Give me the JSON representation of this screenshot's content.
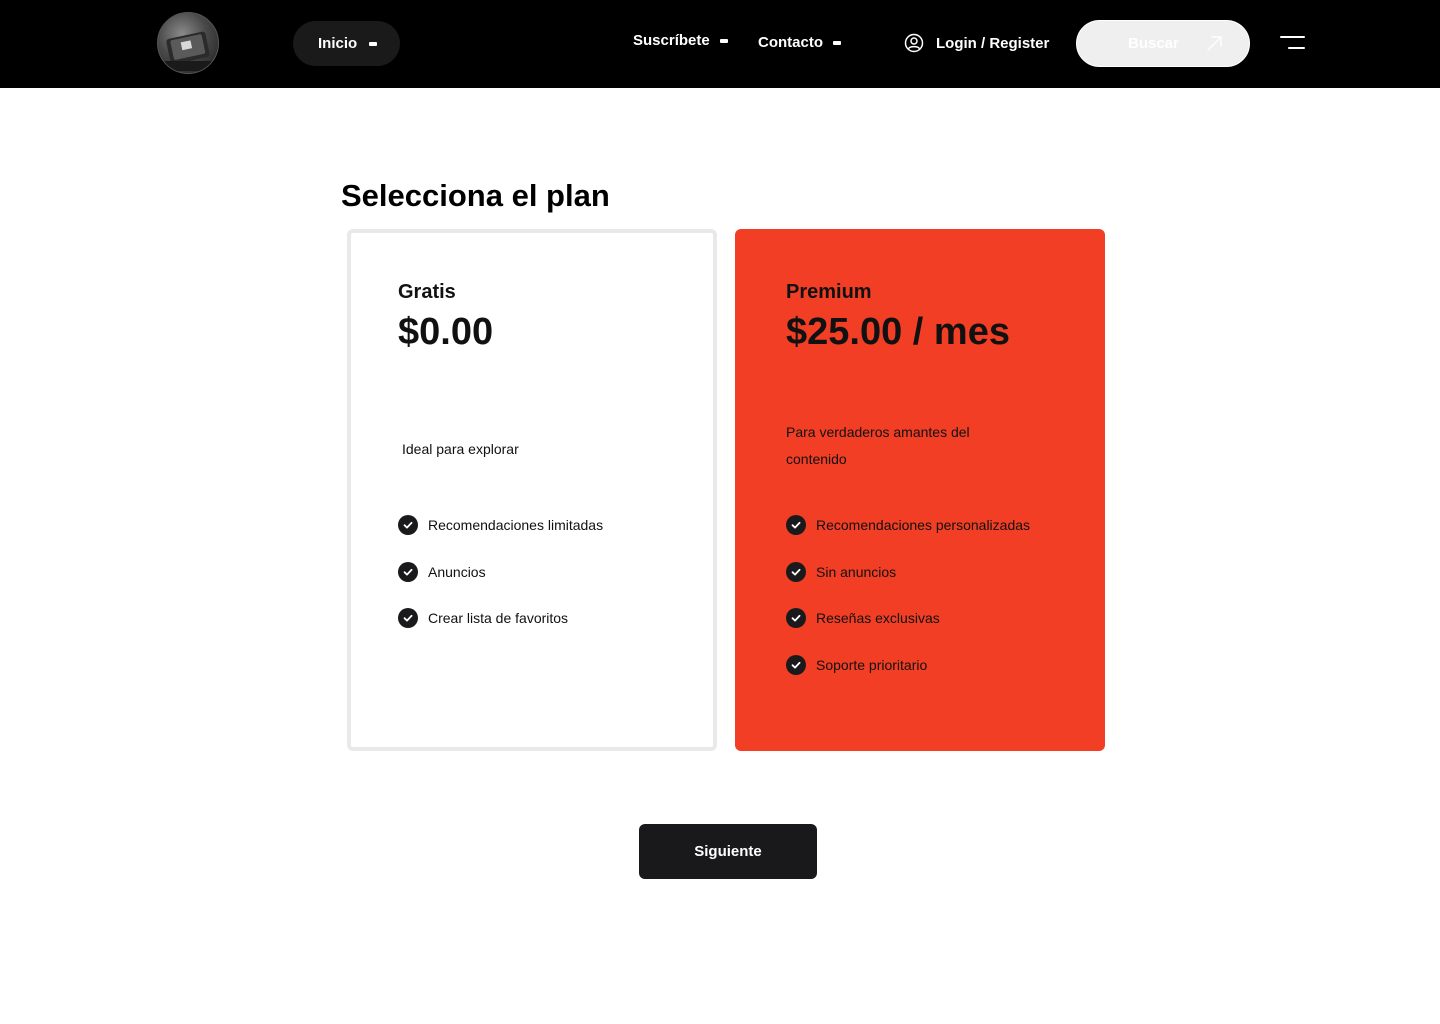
{
  "header": {
    "nav": {
      "inicio": "Inicio",
      "suscribete": "Suscríbete",
      "contacto": "Contacto"
    },
    "login_label": "Login / Register",
    "search_label": "Buscar",
    "icons": {
      "logo": "logo-image",
      "user": "user-circle-icon",
      "arrow": "arrow-up-right-icon",
      "menu": "menu-icon",
      "dropdown": "dash-icon"
    }
  },
  "main": {
    "title": "Selecciona el plan",
    "plans": [
      {
        "name": "Gratis",
        "price": "$0.00",
        "description": "Ideal para explorar",
        "features": [
          "Recomendaciones limitadas",
          "Anuncios",
          "Crear lista de favoritos"
        ]
      },
      {
        "name": "Premium",
        "price": "$25.00 / mes",
        "description": "Para verdaderos amantes del contenido",
        "features": [
          "Recomendaciones personalizadas",
          "Sin anuncios",
          "Reseñas exclusivas",
          "Soporte prioritario"
        ],
        "accent_color": "#f23e24"
      }
    ],
    "next_label": "Siguiente"
  },
  "colors": {
    "header_bg": "#000000",
    "premium_bg": "#f23e24",
    "button_bg": "#19191c",
    "check_bg": "#1a1a1d"
  }
}
